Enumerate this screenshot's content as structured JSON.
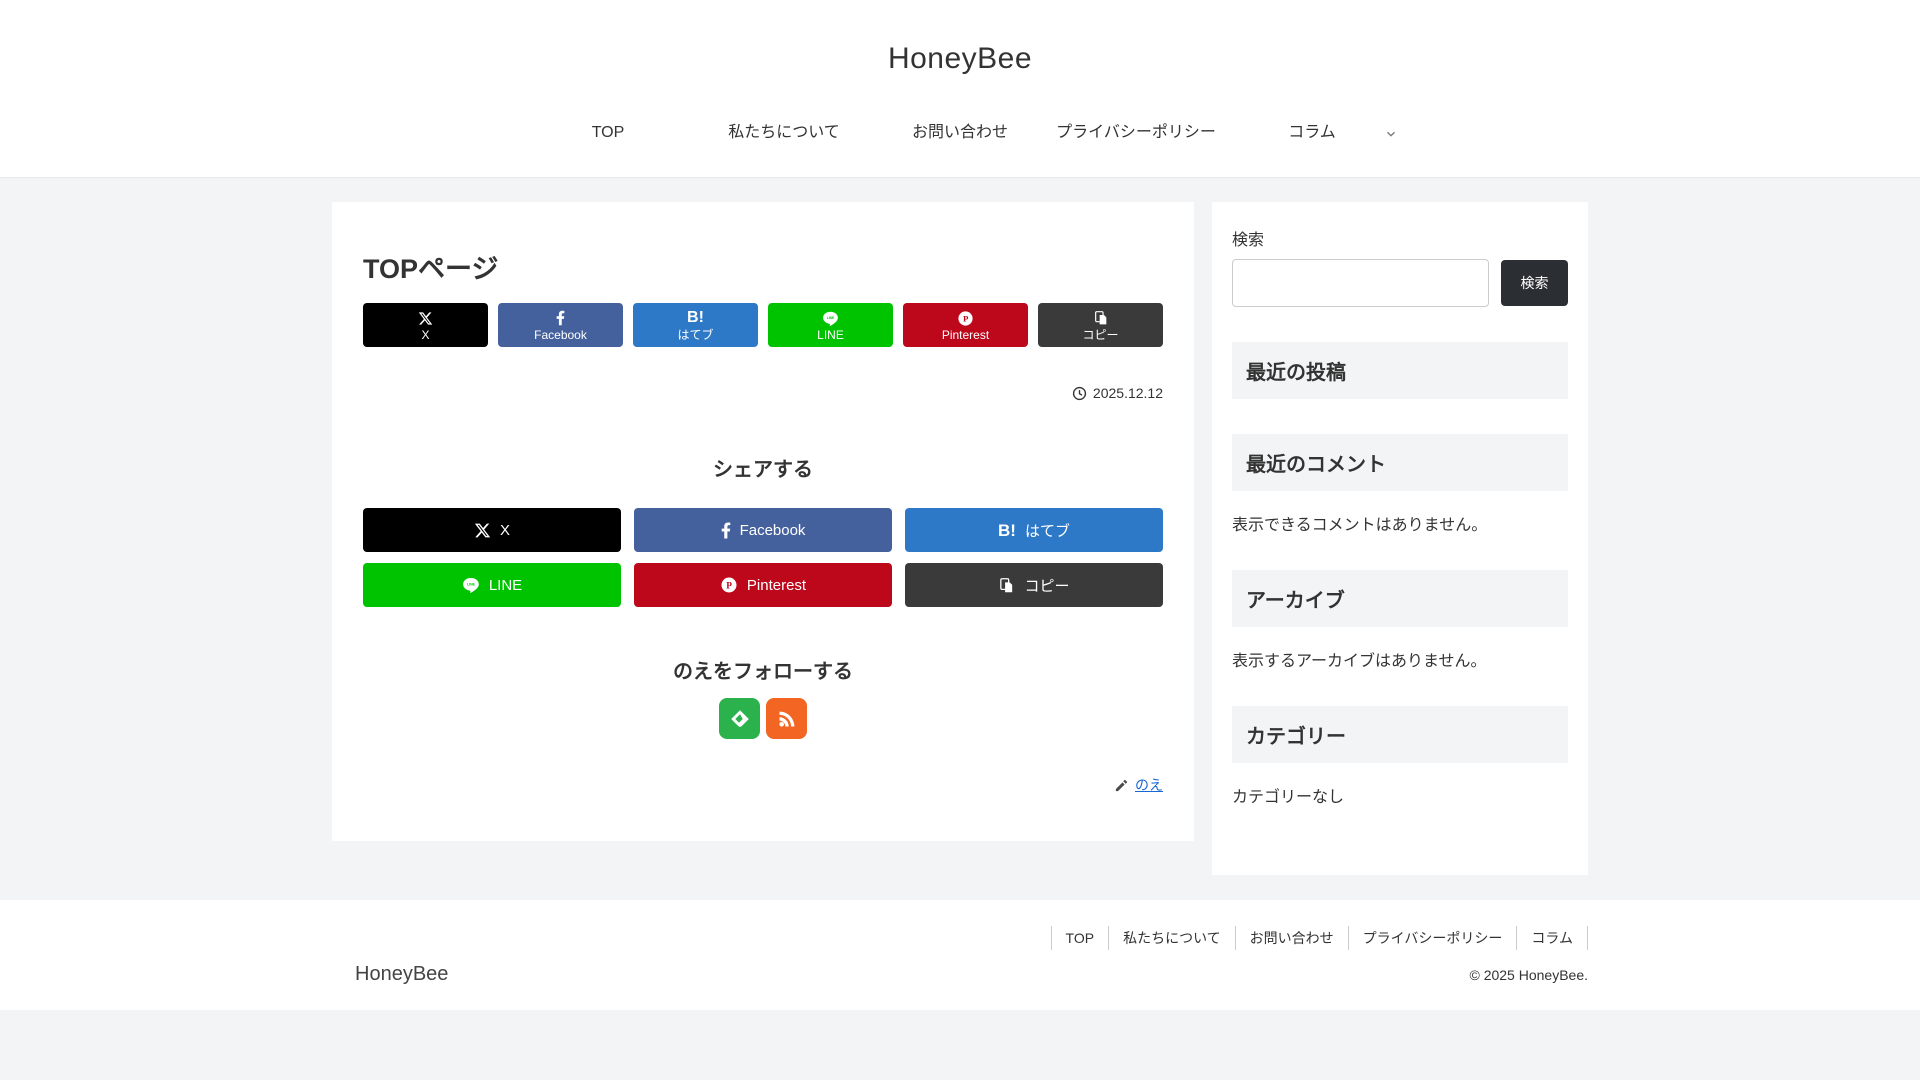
{
  "site": {
    "title": "HoneyBee"
  },
  "nav": {
    "items": [
      "TOP",
      "私たちについて",
      "お問い合わせ",
      "プライバシーポリシー",
      "コラム"
    ]
  },
  "article": {
    "title": "TOPページ",
    "date": "2025.12.12",
    "share_heading": "シェアする",
    "follow_heading": "のえをフォローする",
    "author_link": "のえ"
  },
  "share": {
    "buttons": [
      {
        "id": "x",
        "label": "X"
      },
      {
        "id": "facebook",
        "label": "Facebook"
      },
      {
        "id": "hatena",
        "label": "はてブ"
      },
      {
        "id": "line",
        "label": "LINE"
      },
      {
        "id": "pinterest",
        "label": "Pinterest"
      },
      {
        "id": "copy",
        "label": "コピー"
      }
    ]
  },
  "sidebar": {
    "search": {
      "label": "検索",
      "button": "検索",
      "placeholder": ""
    },
    "widgets": [
      {
        "title": "最近の投稿",
        "body": ""
      },
      {
        "title": "最近のコメント",
        "body": "表示できるコメントはありません。"
      },
      {
        "title": "アーカイブ",
        "body": "表示するアーカイブはありません。"
      },
      {
        "title": "カテゴリー",
        "body": "カテゴリーなし"
      }
    ]
  },
  "footer": {
    "nav": [
      "TOP",
      "私たちについて",
      "お問い合わせ",
      "プライバシーポリシー",
      "コラム"
    ],
    "site_name": "HoneyBee",
    "copyright": "© 2025 HoneyBee."
  },
  "colors": {
    "x": "#000000",
    "facebook": "#45619D",
    "hatena": "#2D79C7",
    "line": "#00C300",
    "pinterest": "#BD081C",
    "copy": "#3A3A3A",
    "feedly": "#2BB24C",
    "rss": "#F26522",
    "link_blue": "#1967D2",
    "search_button": "#2B2F33",
    "widget_heading_bg": "#F3F4F6",
    "page_bg": "#F3F4F6"
  }
}
